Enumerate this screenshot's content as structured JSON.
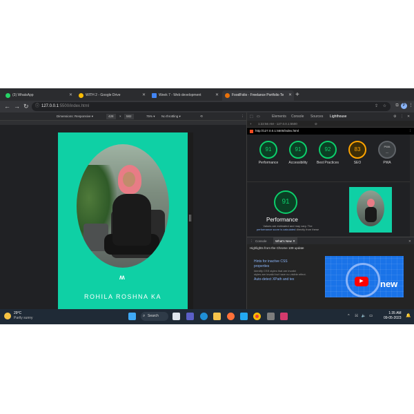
{
  "tabs": [
    {
      "title": "(3) WhatsApp",
      "color": "#25d366"
    },
    {
      "title": "WITH 2 - Google Drive",
      "color": "#fbbc04"
    },
    {
      "title": "Week 7 - Web development",
      "color": "#4285f4"
    },
    {
      "title": "FoodFolio - Freelance Portfolio Te",
      "color": "#e8710a"
    }
  ],
  "new_tab_icon": "+",
  "nav": {
    "back_icon": "←",
    "forward_icon": "→",
    "reload_icon": "↻",
    "url_host": "127.0.0.1",
    "url_path": ":5500/index.html",
    "share_icon": "⇪",
    "star_icon": "☆",
    "puzzle_icon": "⧉",
    "profile_letter": "P",
    "menu_icon": "⋮"
  },
  "device_toolbar": {
    "dimensions_label": "Dimensions: Responsive ▾",
    "width": "428",
    "times": "×",
    "height": "582",
    "zoom": "75% ▾",
    "throttle": "No throttling ▾"
  },
  "portfolio": {
    "logo": "ʍ",
    "hero_text": "ROHILA ROSHNA KA",
    "bg_color": "#0fd0a5"
  },
  "devtools": {
    "tabs": [
      "Elements",
      "Console",
      "Sources",
      "Lighthouse"
    ],
    "active_tab": "Lighthouse",
    "close_icon": "✕",
    "sub_time": "1:22:56 AM - 127.0.0.1:5500",
    "sub_plus": "+",
    "lighthouse_url": "http://127.0.0.1:5500/index.html",
    "more_icon": "⋮",
    "scores": [
      {
        "value": "91",
        "label": "Performance"
      },
      {
        "value": "91",
        "label": "Accessibility"
      },
      {
        "value": "92",
        "label": "Best Practices"
      },
      {
        "value": "83",
        "label": "SEO"
      },
      {
        "value": "PWA",
        "label": "PWA"
      }
    ],
    "perf_score": "91",
    "perf_title": "Performance",
    "perf_note_1": "Values are estimated and may vary. The",
    "perf_note_link": "performance score is calculated",
    "perf_note_2": "directly from these"
  },
  "drawer": {
    "tabs": [
      "Console",
      "What's New ✕"
    ],
    "active_tab": "What's New ✕",
    "close_icon": "✕",
    "highlight": "Highlights from the Chrome 109 update",
    "items": [
      {
        "link": "Hints for inactive CSS",
        "desc": ""
      },
      {
        "link": "properties",
        "desc": "Identify CSS styles that are invalid"
      },
      {
        "link": "",
        "desc": "styles are invalid but have no visible effect."
      },
      {
        "link": "Auto-detect XPath and tex",
        "desc": ""
      }
    ],
    "video_label": "new"
  },
  "taskbar": {
    "temp": "29°C",
    "weather": "Partly sunny",
    "search_label": "Search",
    "tray_chevron": "^",
    "wifi_icon": "☵",
    "volume_icon": "🔈",
    "battery_icon": "▭",
    "time": "1:35 AM",
    "date": "09-05-2023",
    "bell_icon": "🔔"
  }
}
